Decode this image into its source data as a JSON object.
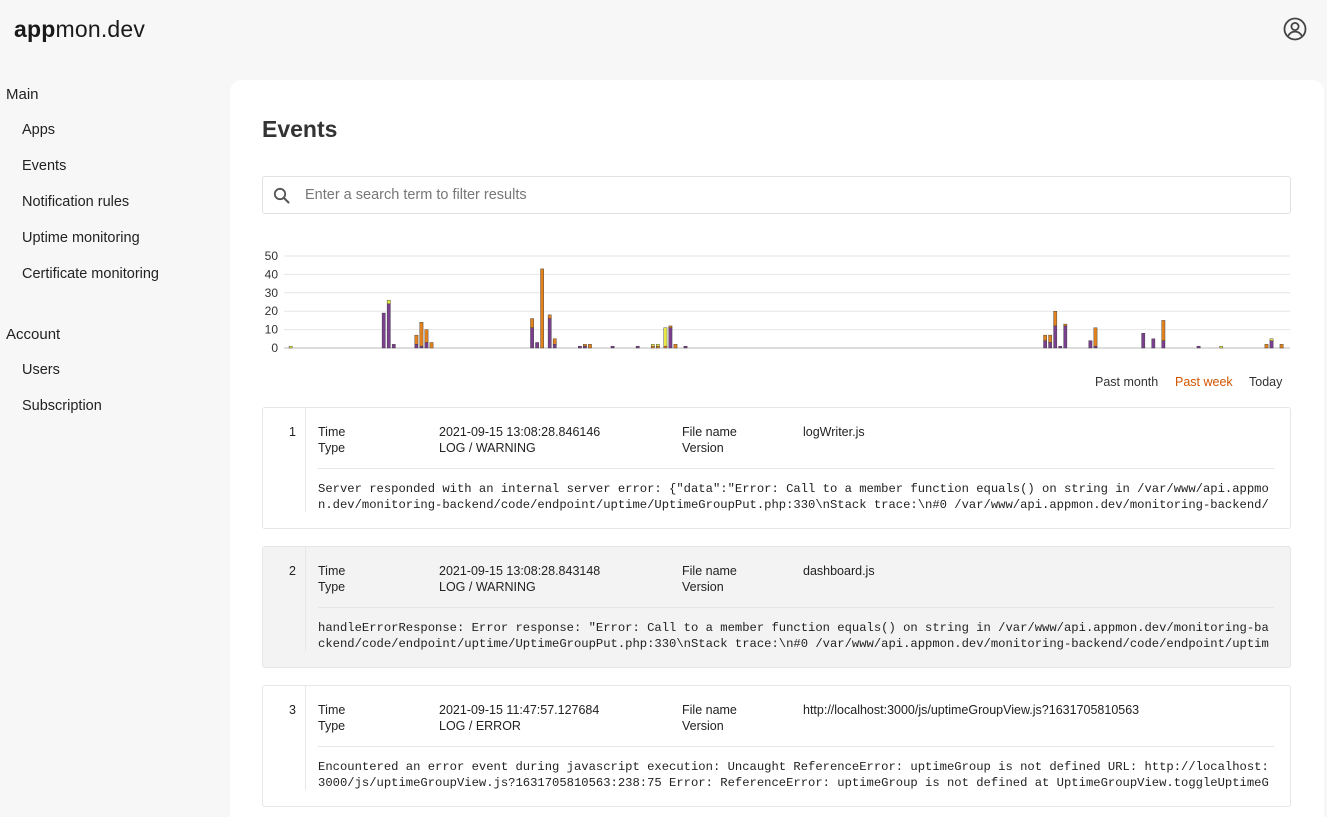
{
  "brand": {
    "bold": "app",
    "rest": "mon.dev"
  },
  "sidebar": {
    "main_heading": "Main",
    "main_items": [
      {
        "label": "Apps"
      },
      {
        "label": "Events"
      },
      {
        "label": "Notification rules"
      },
      {
        "label": "Uptime monitoring"
      },
      {
        "label": "Certificate monitoring"
      }
    ],
    "account_heading": "Account",
    "account_items": [
      {
        "label": "Users"
      },
      {
        "label": "Subscription"
      }
    ]
  },
  "page": {
    "title": "Events"
  },
  "search": {
    "placeholder": "Enter a search term to filter results",
    "value": ""
  },
  "colors": {
    "error": "#7b3f8f",
    "warning": "#e2821f",
    "info": "#e8e84a",
    "accent": "#d35400"
  },
  "chart_data": {
    "type": "bar",
    "stacked": true,
    "ylim": [
      0,
      50
    ],
    "yticks": [
      0,
      10,
      20,
      30,
      40,
      50
    ],
    "grid": true,
    "series_colors": [
      "#7b3f8f",
      "#e2821f",
      "#e8e84a"
    ],
    "bars": [
      {
        "slot": 2,
        "purple": 0,
        "orange": 0,
        "yellow": 1
      },
      {
        "slot": 39,
        "purple": 19,
        "orange": 0,
        "yellow": 0
      },
      {
        "slot": 41,
        "purple": 24,
        "orange": 0,
        "yellow": 2
      },
      {
        "slot": 43,
        "purple": 2,
        "orange": 0,
        "yellow": 0
      },
      {
        "slot": 52,
        "purple": 2,
        "orange": 5,
        "yellow": 0
      },
      {
        "slot": 54,
        "purple": 1,
        "orange": 13,
        "yellow": 0
      },
      {
        "slot": 56,
        "purple": 3,
        "orange": 7,
        "yellow": 0
      },
      {
        "slot": 58,
        "purple": 0,
        "orange": 3,
        "yellow": 0
      },
      {
        "slot": 98,
        "purple": 11,
        "orange": 5,
        "yellow": 0
      },
      {
        "slot": 100,
        "purple": 3,
        "orange": 0,
        "yellow": 0
      },
      {
        "slot": 102,
        "purple": 0,
        "orange": 43,
        "yellow": 0
      },
      {
        "slot": 105,
        "purple": 16,
        "orange": 2,
        "yellow": 0
      },
      {
        "slot": 107,
        "purple": 2,
        "orange": 3,
        "yellow": 0
      },
      {
        "slot": 117,
        "purple": 1,
        "orange": 0,
        "yellow": 0
      },
      {
        "slot": 119,
        "purple": 1,
        "orange": 1,
        "yellow": 0
      },
      {
        "slot": 121,
        "purple": 0,
        "orange": 2,
        "yellow": 0
      },
      {
        "slot": 130,
        "purple": 1,
        "orange": 0,
        "yellow": 0
      },
      {
        "slot": 140,
        "purple": 1,
        "orange": 0,
        "yellow": 0
      },
      {
        "slot": 146,
        "purple": 0,
        "orange": 1,
        "yellow": 1
      },
      {
        "slot": 148,
        "purple": 0,
        "orange": 1,
        "yellow": 1
      },
      {
        "slot": 151,
        "purple": 0,
        "orange": 1,
        "yellow": 10
      },
      {
        "slot": 153,
        "purple": 11,
        "orange": 1,
        "yellow": 0
      },
      {
        "slot": 155,
        "purple": 0,
        "orange": 2,
        "yellow": 0
      },
      {
        "slot": 159,
        "purple": 1,
        "orange": 0,
        "yellow": 0
      },
      {
        "slot": 302,
        "purple": 4,
        "orange": 3,
        "yellow": 0
      },
      {
        "slot": 304,
        "purple": 3,
        "orange": 4,
        "yellow": 0
      },
      {
        "slot": 306,
        "purple": 12,
        "orange": 8,
        "yellow": 0
      },
      {
        "slot": 308,
        "purple": 1,
        "orange": 0,
        "yellow": 0
      },
      {
        "slot": 310,
        "purple": 12,
        "orange": 1,
        "yellow": 0
      },
      {
        "slot": 320,
        "purple": 4,
        "orange": 0,
        "yellow": 0
      },
      {
        "slot": 322,
        "purple": 1,
        "orange": 10,
        "yellow": 0
      },
      {
        "slot": 341,
        "purple": 8,
        "orange": 0,
        "yellow": 0
      },
      {
        "slot": 345,
        "purple": 5,
        "orange": 0,
        "yellow": 0
      },
      {
        "slot": 349,
        "purple": 4,
        "orange": 11,
        "yellow": 0
      },
      {
        "slot": 363,
        "purple": 1,
        "orange": 0,
        "yellow": 0
      },
      {
        "slot": 372,
        "purple": 0,
        "orange": 0,
        "yellow": 1
      },
      {
        "slot": 390,
        "purple": 0,
        "orange": 2,
        "yellow": 0
      },
      {
        "slot": 392,
        "purple": 4,
        "orange": 0,
        "yellow": 1
      },
      {
        "slot": 396,
        "purple": 0,
        "orange": 2,
        "yellow": 0
      }
    ],
    "slot_count": 400
  },
  "ranges": [
    {
      "label": "Past month",
      "active": false
    },
    {
      "label": "Past week",
      "active": true
    },
    {
      "label": "Today",
      "active": false
    }
  ],
  "events": [
    {
      "index": "1",
      "time_label": "Time",
      "time": "2021-09-15 13:08:28.846146",
      "type_label": "Type",
      "type": "LOG / WARNING",
      "file_label": "File name",
      "file": "logWriter.js",
      "version_label": "Version",
      "version": "",
      "message": "Server responded with an internal server error: {\"data\":\"Error: Call to a member function equals() on string in /var/www/api.appmon.dev/monitoring-backend/code/endpoint/uptime/UptimeGroupPut.php:330\\nStack trace:\\n#0 /var/www/api.appmon.dev/monitoring-backend/cod…"
    },
    {
      "index": "2",
      "time_label": "Time",
      "time": "2021-09-15 13:08:28.843148",
      "type_label": "Type",
      "type": "LOG / WARNING",
      "file_label": "File name",
      "file": "dashboard.js",
      "version_label": "Version",
      "version": "",
      "message": "handleErrorResponse: Error response: \"Error: Call to a member function equals() on string in /var/www/api.appmon.dev/monitoring-backend/code/endpoint/uptime/UptimeGroupPut.php:330\\nStack trace:\\n#0 /var/www/api.appmon.dev/monitoring-backend/code/endpoint/uptime/U…"
    },
    {
      "index": "3",
      "time_label": "Time",
      "time": "2021-09-15 11:47:57.127684",
      "type_label": "Type",
      "type": "LOG / ERROR",
      "file_label": "File name",
      "file": "http://localhost:3000/js/uptimeGroupView.js?1631705810563",
      "version_label": "Version",
      "version": "",
      "message": "Encountered an error event during javascript execution: Uncaught ReferenceError: uptimeGroup is not defined URL: http://localhost:3000/js/uptimeGroupView.js?1631705810563:238:75 Error: ReferenceError: uptimeGroup is not defined at UptimeGroupView.toggleUptimeGrou…"
    }
  ]
}
